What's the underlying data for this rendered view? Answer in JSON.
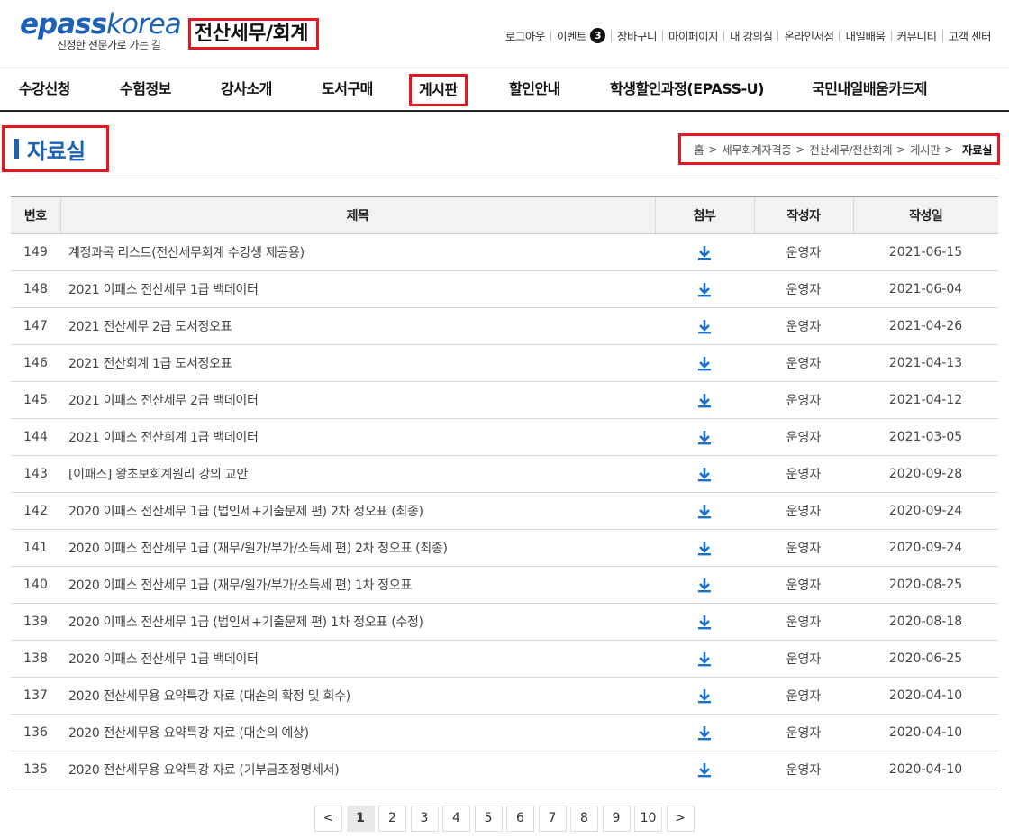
{
  "header": {
    "logo": "epasskorea",
    "tagline": "진정한 전문가로 가는 길",
    "category_title": "전산세무/회계",
    "util_links": [
      "로그아웃",
      "이벤트",
      "장바구니",
      "마이페이지",
      "내 강의실",
      "온라인서점",
      "내일배움",
      "커뮤니티",
      "고객 센터"
    ],
    "event_badge": "3"
  },
  "gnb": [
    "수강신청",
    "수험정보",
    "강사소개",
    "도서구매",
    "게시판",
    "할인안내",
    "학생할인과정(EPASS-U)",
    "국민내일배움카드제"
  ],
  "page": {
    "title": "자료실",
    "breadcrumb": [
      "홈",
      "세무회계자격증",
      "전산세무/전산회계",
      "게시판"
    ],
    "breadcrumb_current": "자료실"
  },
  "table": {
    "headers": [
      "번호",
      "제목",
      "첨부",
      "작성자",
      "작성일"
    ],
    "rows": [
      {
        "no": "149",
        "title": "계정과목 리스트(전산세무회계 수강생 제공용)",
        "author": "운영자",
        "date": "2021-06-15"
      },
      {
        "no": "148",
        "title": "2021 이패스 전산세무 1급 백데이터",
        "author": "운영자",
        "date": "2021-06-04"
      },
      {
        "no": "147",
        "title": "2021 전산세무 2급 도서정오표",
        "author": "운영자",
        "date": "2021-04-26"
      },
      {
        "no": "146",
        "title": "2021 전산회계 1급 도서정오표",
        "author": "운영자",
        "date": "2021-04-13"
      },
      {
        "no": "145",
        "title": "2021 이패스 전산세무 2급 백데이터",
        "author": "운영자",
        "date": "2021-04-12"
      },
      {
        "no": "144",
        "title": "2021 이패스 전산회계 1급 백데이터",
        "author": "운영자",
        "date": "2021-03-05"
      },
      {
        "no": "143",
        "title": "[이패스] 왕초보회계원리 강의 교안",
        "author": "운영자",
        "date": "2020-09-28"
      },
      {
        "no": "142",
        "title": "2020 이패스 전산세무 1급 (법인세+기출문제 편) 2차 정오표 (최종)",
        "author": "운영자",
        "date": "2020-09-24"
      },
      {
        "no": "141",
        "title": "2020 이패스 전산세무 1급 (재무/원가/부가/소득세 편) 2차 정오표 (최종)",
        "author": "운영자",
        "date": "2020-09-24"
      },
      {
        "no": "140",
        "title": "2020 이패스 전산세무 1급 (재무/원가/부가/소득세 편) 1차 정오표",
        "author": "운영자",
        "date": "2020-08-25"
      },
      {
        "no": "139",
        "title": "2020 이패스 전산세무 1급 (법인세+기출문제 편) 1차 정오표 (수정)",
        "author": "운영자",
        "date": "2020-08-18"
      },
      {
        "no": "138",
        "title": "2020 이패스 전산세무 1급 백데이터",
        "author": "운영자",
        "date": "2020-06-25"
      },
      {
        "no": "137",
        "title": "2020 전산세무용 요약특강 자료 (대손의 확정 및 회수)",
        "author": "운영자",
        "date": "2020-04-10"
      },
      {
        "no": "136",
        "title": "2020 전산세무용 요약특강 자료 (대손의 예상)",
        "author": "운영자",
        "date": "2020-04-10"
      },
      {
        "no": "135",
        "title": "2020 전산세무용 요약특강 자료 (기부금조정명세서)",
        "author": "운영자",
        "date": "2020-04-10"
      }
    ],
    "attachment_icon": "download-icon"
  },
  "pagination": {
    "prev": "<",
    "pages": [
      "1",
      "2",
      "3",
      "4",
      "5",
      "6",
      "7",
      "8",
      "9",
      "10"
    ],
    "next": ">",
    "current": "1"
  },
  "colors": {
    "brand_blue": "#1d62b6",
    "download_blue": "#1a73c9",
    "highlight_red": "#e8161f"
  }
}
